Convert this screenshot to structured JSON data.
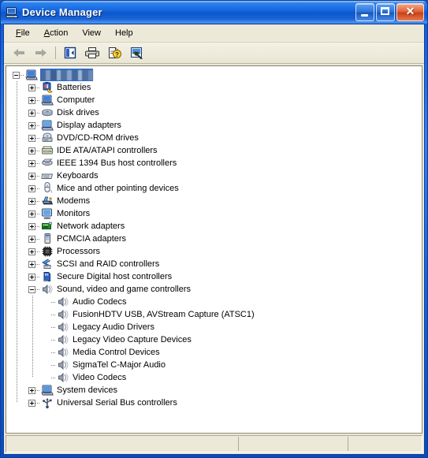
{
  "window": {
    "title": "Device Manager",
    "icon": "device-manager-icon",
    "caption_buttons": {
      "minimize": "minimize-button",
      "maximize": "maximize-button",
      "close_label": "✕"
    },
    "colors": {
      "titlebar_blue": "#0a62d6",
      "frame_blue": "#1c4eb4",
      "client_beige": "#ece9d8",
      "selection_blue": "#316ac5",
      "tree_bg": "#ffffff"
    }
  },
  "menu": {
    "items": [
      {
        "label": "File",
        "accel": "F",
        "name": "menu-file"
      },
      {
        "label": "Action",
        "accel": "A",
        "name": "menu-action"
      },
      {
        "label": "View",
        "accel": "V",
        "name": "menu-view"
      },
      {
        "label": "Help",
        "accel": "H",
        "name": "menu-help"
      }
    ]
  },
  "toolbar": {
    "buttons": [
      {
        "name": "back-arrow-icon",
        "tooltip": "Back",
        "enabled": false
      },
      {
        "name": "forward-arrow-icon",
        "tooltip": "Forward",
        "enabled": false
      },
      {
        "name": "show-hide-console-tree-icon",
        "tooltip": "Show/Hide Console Tree",
        "enabled": true
      },
      {
        "name": "print-icon",
        "tooltip": "Print",
        "enabled": true
      },
      {
        "name": "properties-help-icon",
        "tooltip": "Properties",
        "enabled": true
      },
      {
        "name": "scan-for-hardware-changes-icon",
        "tooltip": "Scan for hardware changes",
        "enabled": true
      }
    ]
  },
  "tree": {
    "root": {
      "label": "",
      "redacted": true,
      "selected": true,
      "expanded": true,
      "icon": "computer-icon",
      "name": "tree-root-computer"
    },
    "nodes": [
      {
        "label": "Batteries",
        "icon": "battery-icon",
        "expanded": false,
        "depth": 1
      },
      {
        "label": "Computer",
        "icon": "computer-icon",
        "expanded": false,
        "depth": 1
      },
      {
        "label": "Disk drives",
        "icon": "disk-drive-icon",
        "expanded": false,
        "depth": 1
      },
      {
        "label": "Display adapters",
        "icon": "display-icon",
        "expanded": false,
        "depth": 1
      },
      {
        "label": "DVD/CD-ROM drives",
        "icon": "cdrom-icon",
        "expanded": false,
        "depth": 1
      },
      {
        "label": "IDE ATA/ATAPI controllers",
        "icon": "ide-controller-icon",
        "expanded": false,
        "depth": 1
      },
      {
        "label": "IEEE 1394 Bus host controllers",
        "icon": "ieee1394-icon",
        "expanded": false,
        "depth": 1
      },
      {
        "label": "Keyboards",
        "icon": "keyboard-icon",
        "expanded": false,
        "depth": 1
      },
      {
        "label": "Mice and other pointing devices",
        "icon": "mouse-icon",
        "expanded": false,
        "depth": 1
      },
      {
        "label": "Modems",
        "icon": "modem-icon",
        "expanded": false,
        "depth": 1
      },
      {
        "label": "Monitors",
        "icon": "monitor-icon",
        "expanded": false,
        "depth": 1
      },
      {
        "label": "Network adapters",
        "icon": "network-adapter-icon",
        "expanded": false,
        "depth": 1
      },
      {
        "label": "PCMCIA adapters",
        "icon": "pcmcia-icon",
        "expanded": false,
        "depth": 1
      },
      {
        "label": "Processors",
        "icon": "processor-icon",
        "expanded": false,
        "depth": 1
      },
      {
        "label": "SCSI and RAID controllers",
        "icon": "scsi-raid-icon",
        "expanded": false,
        "depth": 1
      },
      {
        "label": "Secure Digital host controllers",
        "icon": "sd-host-icon",
        "expanded": false,
        "depth": 1
      },
      {
        "label": "Sound, video and game controllers",
        "icon": "sound-icon",
        "expanded": true,
        "depth": 1
      },
      {
        "label": "Audio Codecs",
        "icon": "sound-icon",
        "leaf": true,
        "depth": 2
      },
      {
        "label": "FusionHDTV USB, AVStream Capture (ATSC1)",
        "icon": "sound-icon",
        "leaf": true,
        "depth": 2
      },
      {
        "label": "Legacy Audio Drivers",
        "icon": "sound-icon",
        "leaf": true,
        "depth": 2
      },
      {
        "label": "Legacy Video Capture Devices",
        "icon": "sound-icon",
        "leaf": true,
        "depth": 2
      },
      {
        "label": "Media Control Devices",
        "icon": "sound-icon",
        "leaf": true,
        "depth": 2
      },
      {
        "label": "SigmaTel C-Major Audio",
        "icon": "sound-icon",
        "leaf": true,
        "depth": 2
      },
      {
        "label": "Video Codecs",
        "icon": "sound-icon",
        "leaf": true,
        "depth": 2
      },
      {
        "label": "System devices",
        "icon": "system-device-icon",
        "expanded": false,
        "depth": 1
      },
      {
        "label": "Universal Serial Bus controllers",
        "icon": "usb-icon",
        "expanded": false,
        "depth": 1
      }
    ]
  },
  "statusbar": {
    "pane1": "",
    "pane2": "",
    "pane3": ""
  }
}
